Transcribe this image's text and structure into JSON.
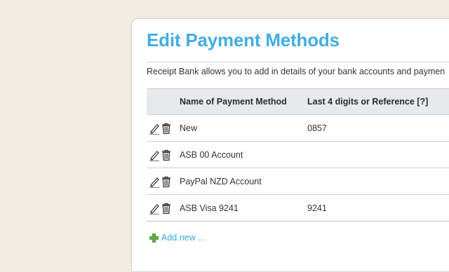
{
  "page": {
    "title": "Edit Payment Methods",
    "intro": "Receipt Bank allows you to add in details of your bank accounts and paymen"
  },
  "table": {
    "headers": {
      "name": "Name of Payment Method",
      "reference": "Last 4 digits or Reference [?]"
    },
    "rows": [
      {
        "name": "New",
        "reference": "0857"
      },
      {
        "name": "ASB 00 Account",
        "reference": ""
      },
      {
        "name": "PayPal NZD Account",
        "reference": ""
      },
      {
        "name": "ASB Visa 9241",
        "reference": "9241"
      }
    ]
  },
  "actions": {
    "add_new": "Add new ..."
  },
  "icons": {
    "edit": "pencil-icon",
    "delete": "trash-icon",
    "add": "plus-icon"
  },
  "colors": {
    "accent": "#42ade2",
    "link": "#3aa6dc",
    "add_green": "#5cb040",
    "header_bg": "#e6eaed",
    "page_bg": "#f1ede3"
  }
}
